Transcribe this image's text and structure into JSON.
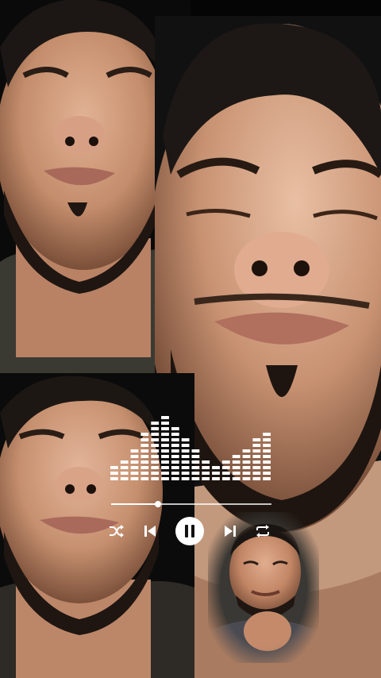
{
  "screen": {
    "description_free": true
  },
  "photos": {
    "top_left_icon": "face-photo",
    "large_icon": "face-photo",
    "bottom_left_icon": "face-photo",
    "thumbnail_icon": "face-photo"
  },
  "player": {
    "visualizer_levels": [
      3,
      4,
      6,
      9,
      11,
      12,
      10,
      8,
      6,
      4,
      3,
      4,
      5,
      6,
      8,
      9
    ],
    "visualizer_max": 12,
    "progress_fraction": 0.29,
    "is_playing": true,
    "icons": {
      "shuffle": "shuffle-icon",
      "previous": "skip-previous-icon",
      "play_pause": "pause-icon",
      "next": "skip-next-icon",
      "repeat": "repeat-icon"
    },
    "accent_color": "#ffffff"
  }
}
